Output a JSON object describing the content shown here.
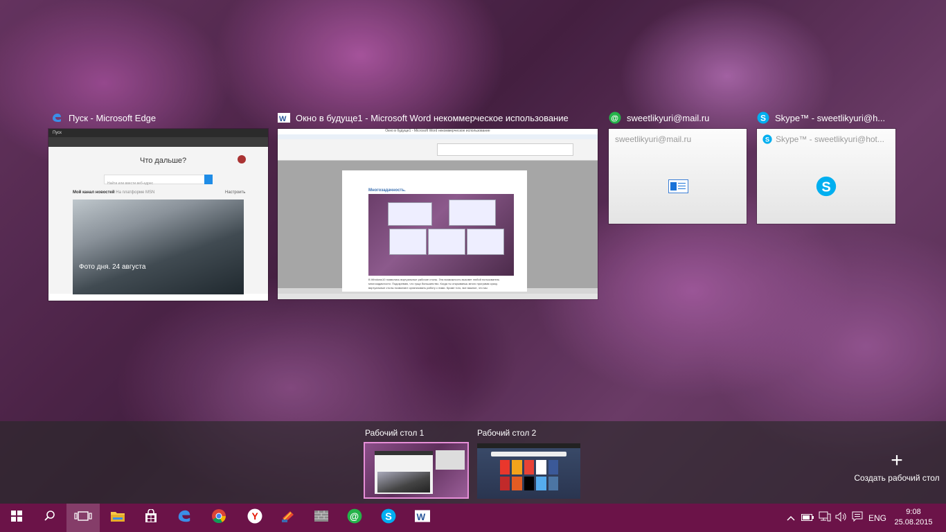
{
  "windows": [
    {
      "title": "Пуск - Microsoft Edge",
      "icon": "edge-icon"
    },
    {
      "title": "Окно в будуще1 - Microsoft Word некоммерческое использование",
      "icon": "word-icon"
    },
    {
      "title": "sweetlikyuri@mail.ru",
      "icon": "mail-agent-icon"
    },
    {
      "title": "Skype™ - sweetlikyuri@h...",
      "icon": "skype-icon"
    }
  ],
  "edge_preview": {
    "tab_title": "Пуск",
    "question": "Что дальше?",
    "search_placeholder": "Найти или ввести веб-адрес",
    "news_title": "Мой канал новостей",
    "news_subtitle": "На платформе MSN",
    "customize": "Настроить",
    "photo_caption": "Фото дня. 24 августа"
  },
  "word_preview": {
    "window_title": "Окно в будуще1 - Microsoft Word некоммерческое использование",
    "heading": "Многозадачность.",
    "body_text": "В Windows10 появились виртуальные рабочие столы. Эта возможность вызовет любой пользователь многозадачности. Подозреваю, что гуща большинство. Когда ты открываешь много программ сразу, виртуальные столы позволяют организовать работу с ними. Кроме того, все важное, что мы"
  },
  "mail_preview": {
    "text": "sweetlikyuri@mail.ru"
  },
  "skype_preview": {
    "text": "Skype™ - sweetlikyuri@hot..."
  },
  "desktops": [
    {
      "label": "Рабочий стол 1",
      "active": true
    },
    {
      "label": "Рабочий стол 2",
      "active": false
    }
  ],
  "new_desktop_label": "Создать рабочий стол",
  "taskbar": {
    "apps": [
      "start-icon",
      "search-icon",
      "task-view-icon",
      "file-explorer-icon",
      "store-icon",
      "edge-icon",
      "chrome-icon",
      "yandex-icon",
      "ccleaner-icon",
      "firewall-icon",
      "mail-agent-icon",
      "skype-icon",
      "word-icon"
    ],
    "language": "ENG",
    "time": "9:08",
    "date": "25.08.2015"
  },
  "colors": {
    "taskbar": "#6b1348",
    "accent": "#e78fd8"
  }
}
